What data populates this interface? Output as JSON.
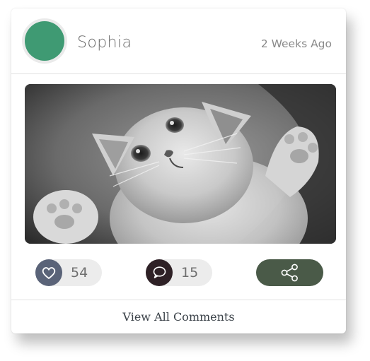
{
  "post": {
    "user": {
      "name": "Sophia",
      "avatar_color": "#3f9a73"
    },
    "timestamp": "2 Weeks Ago",
    "image_alt": "kitten-photo",
    "likes": {
      "icon": "heart-icon",
      "count": "54",
      "color": "#5a6378"
    },
    "comments": {
      "icon": "speech-bubble-icon",
      "count": "15",
      "color": "#2e2126"
    },
    "share": {
      "icon": "share-icon",
      "color": "#4a5a48"
    },
    "view_all_comments_label": "View All Comments"
  }
}
